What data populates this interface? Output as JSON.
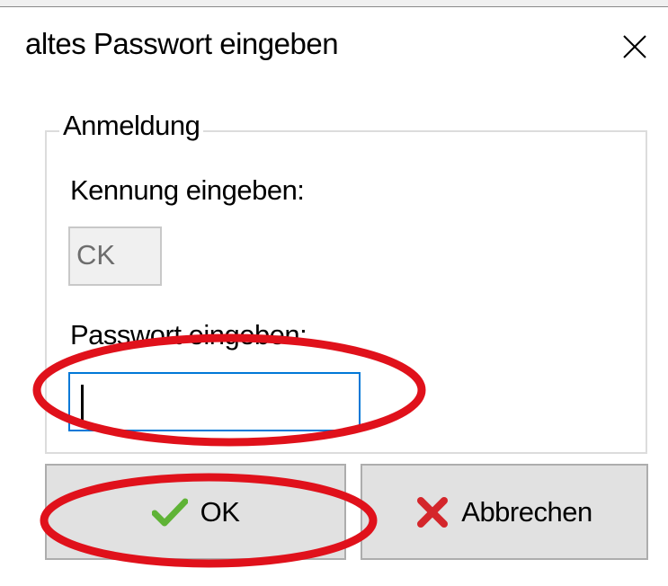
{
  "window": {
    "title": "altes Passwort eingeben"
  },
  "group": {
    "legend": "Anmeldung",
    "kennung_label": "Kennung eingeben:",
    "kennung_value": "CK",
    "passwort_label": "Passwort eingeben:",
    "passwort_value": ""
  },
  "buttons": {
    "ok_label": "OK",
    "ok_icon": "checkmark-icon",
    "cancel_label": "Abbrechen",
    "cancel_icon": "x-icon"
  },
  "colors": {
    "focus_border": "#0078d7",
    "annotation_red": "#e0111b",
    "check_green": "#5fb336",
    "cancel_red": "#d4262b"
  }
}
